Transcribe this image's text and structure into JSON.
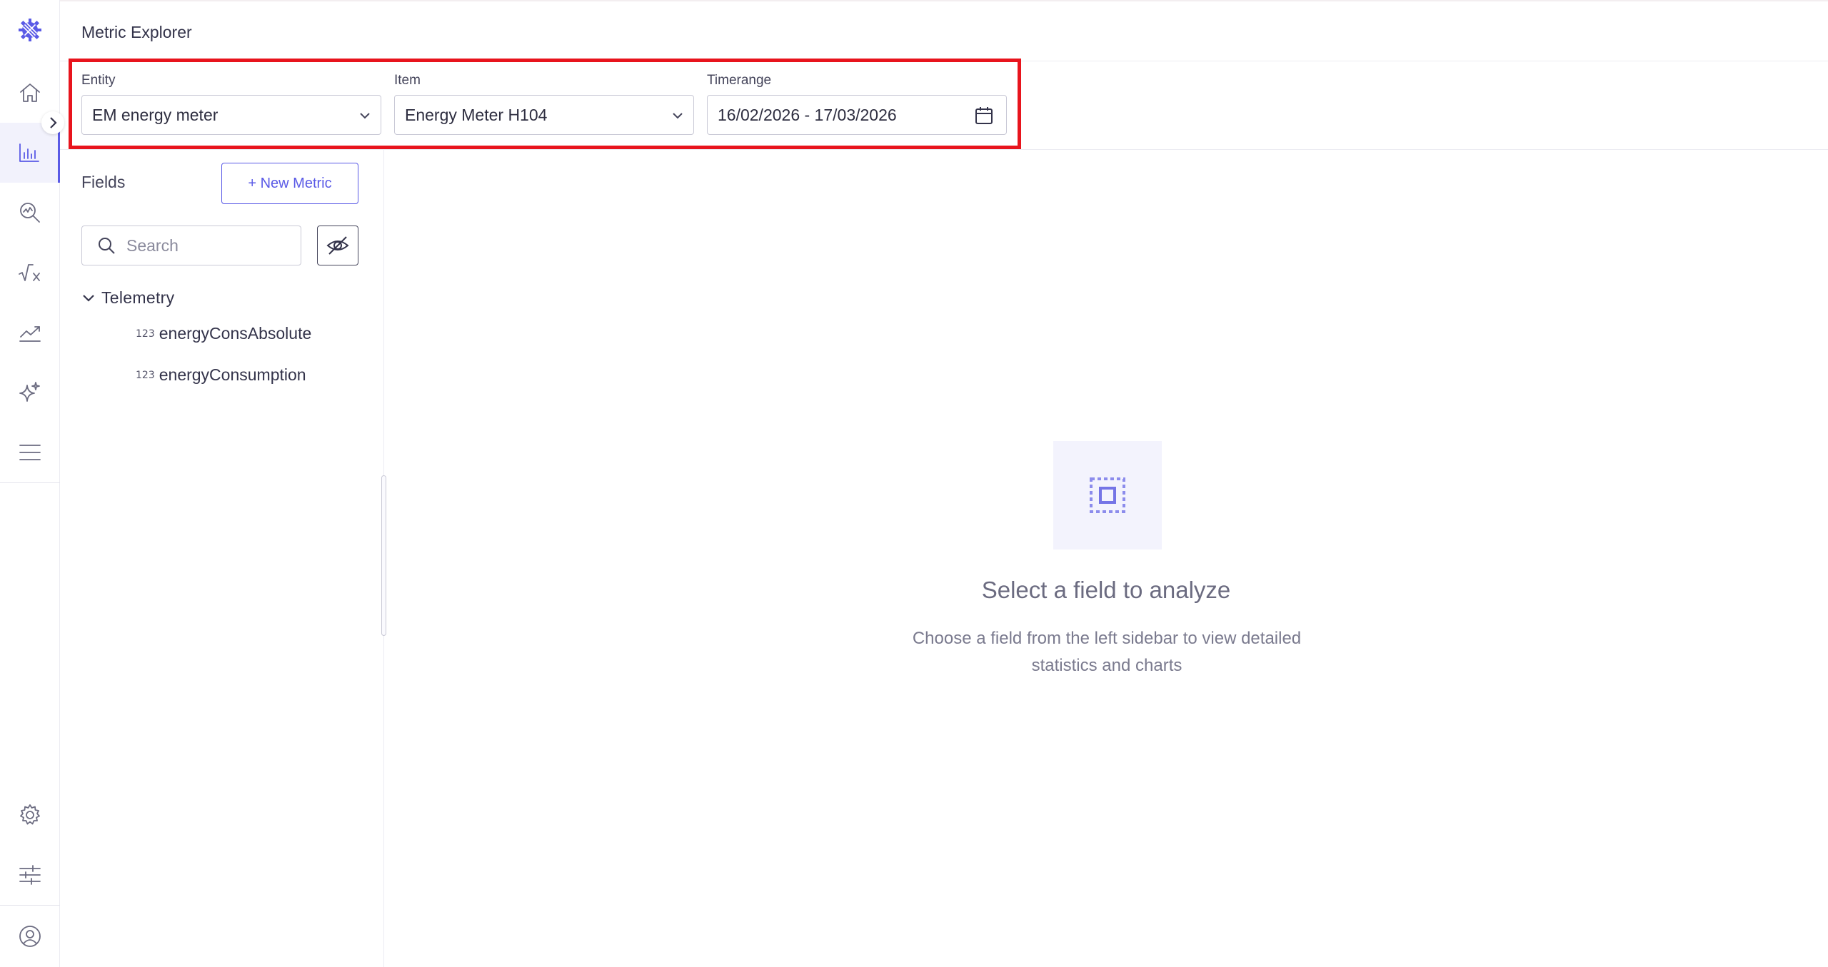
{
  "app": {
    "title": "Metric Explorer",
    "accent_color": "#5a5ae6",
    "highlight_color": "#e8141d"
  },
  "sidebar": {
    "logo": "gear-logo-icon",
    "items": [
      {
        "name": "home",
        "icon": "home-icon",
        "active": false
      },
      {
        "name": "metric-explorer",
        "icon": "bar-chart-icon",
        "active": true
      },
      {
        "name": "analyze",
        "icon": "search-chart-icon",
        "active": false
      },
      {
        "name": "formula",
        "icon": "sqrt-icon",
        "active": false
      },
      {
        "name": "trends",
        "icon": "trend-line-icon",
        "active": false
      },
      {
        "name": "ai",
        "icon": "sparkle-icon",
        "active": false
      },
      {
        "name": "menu",
        "icon": "menu-icon",
        "active": false
      }
    ],
    "bottom_items": [
      {
        "name": "settings",
        "icon": "gear-icon"
      },
      {
        "name": "adjustments",
        "icon": "sliders-icon"
      },
      {
        "name": "profile",
        "icon": "user-icon"
      }
    ]
  },
  "filters": {
    "entity": {
      "label": "Entity",
      "value": "EM energy meter"
    },
    "item": {
      "label": "Item",
      "value": "Energy Meter H104"
    },
    "timerange": {
      "label": "Timerange",
      "value": "16/02/2026 - 17/03/2026"
    }
  },
  "fields_panel": {
    "title": "Fields",
    "new_metric_label": "+ New Metric",
    "search_placeholder": "Search",
    "groups": [
      {
        "label": "Telemetry",
        "expanded": true,
        "fields": [
          {
            "type": "123",
            "name": "energyConsAbsolute"
          },
          {
            "type": "123",
            "name": "energyConsumption"
          }
        ]
      }
    ]
  },
  "empty_state": {
    "title": "Select a field to analyze",
    "description": "Choose a field from the left sidebar to view detailed statistics and charts"
  }
}
